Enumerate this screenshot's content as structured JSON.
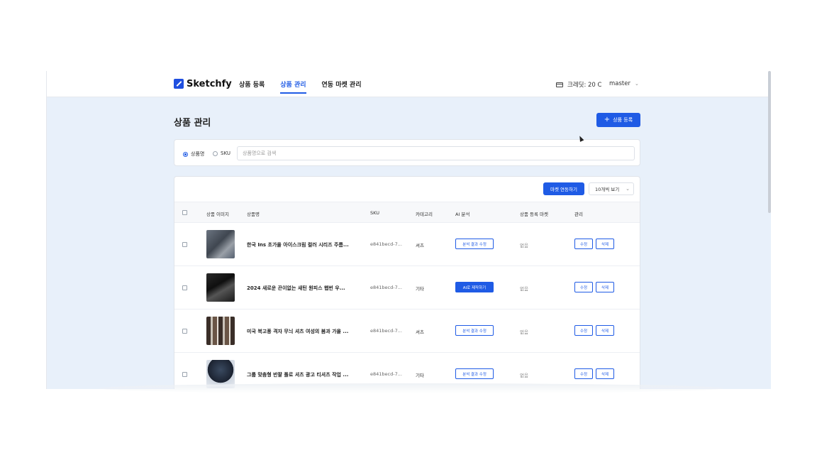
{
  "header": {
    "logo_text": "Sketchfy",
    "nav": [
      {
        "label": "상품 등록",
        "active": false
      },
      {
        "label": "상품 관리",
        "active": true
      },
      {
        "label": "연동 마켓 관리",
        "active": false
      }
    ],
    "credit_label": "크레딧: 20 C",
    "user_name": "master"
  },
  "page": {
    "title": "상품 관리",
    "add_button_label": "상품 등록"
  },
  "search": {
    "radio_options": [
      {
        "label": "상품명",
        "selected": true
      },
      {
        "label": "SKU",
        "selected": false
      }
    ],
    "placeholder": "상품명으로 검색"
  },
  "table": {
    "market_link_button": "마켓 연동하기",
    "page_size": "10개씩 보기",
    "headers": [
      "상품 이미지",
      "상품명",
      "SKU",
      "카테고리",
      "AI 분석",
      "상품 등록 마켓",
      "관리"
    ],
    "rows": [
      {
        "name": "한국 Ins 초가을 아이스크림 컬러 시리즈 주름...",
        "sku": "e841becd-7...",
        "category": "셔츠",
        "ai_label": "분석 결과 수정",
        "ai_primary": false,
        "market": "없음",
        "edit": "수정",
        "delete": "삭제"
      },
      {
        "name": "2024 새로운 끈이없는 새틴 원피스 햅번 우...",
        "sku": "e841becd-7...",
        "category": "기타",
        "ai_label": "AI로 제작하기",
        "ai_primary": true,
        "market": "없음",
        "edit": "수정",
        "delete": "삭제"
      },
      {
        "name": "미국 복고풍 격자 무늬 셔츠 여성의 봄과 가을 ...",
        "sku": "e841becd-7...",
        "category": "셔츠",
        "ai_label": "분석 결과 수정",
        "ai_primary": false,
        "market": "없음",
        "edit": "수정",
        "delete": "삭제"
      },
      {
        "name": "그룹 맞춤형 반팔 폴로 셔츠 광고 티셔츠 작업 ...",
        "sku": "e841becd-7...",
        "category": "기타",
        "ai_label": "분석 결과 수정",
        "ai_primary": false,
        "market": "없음",
        "edit": "수정",
        "delete": "삭제"
      }
    ]
  },
  "colors": {
    "accent": "#1f5be5",
    "background": "#e8f0fa"
  },
  "icons": {
    "credit": "credit-card-icon",
    "add": "plus-icon",
    "dropdown": "chevron-down-icon",
    "cursor": "mouse-pointer-icon"
  }
}
